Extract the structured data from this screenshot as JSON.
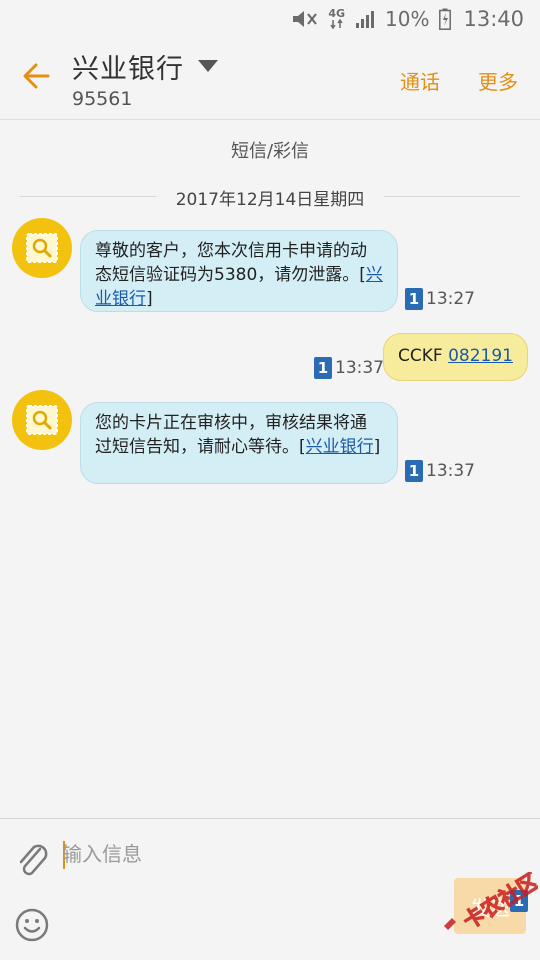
{
  "status_bar": {
    "network": "4G",
    "battery": "10%",
    "time": "13:40"
  },
  "header": {
    "contact_name": "兴业银行",
    "contact_number": "95561",
    "call_label": "通话",
    "more_label": "更多"
  },
  "conversation": {
    "type_label": "短信/彩信",
    "date_label": "2017年12月14日星期四",
    "messages": [
      {
        "direction": "incoming",
        "text": "尊敬的客户，您本次信用卡申请的动态短信验证码为5380，请勿泄露。[",
        "link": "兴业银行",
        "suffix": "]",
        "sim": "1",
        "time": "13:27"
      },
      {
        "direction": "outgoing",
        "text": "CCKF ",
        "link": "082191",
        "sim": "1",
        "time": "13:37"
      },
      {
        "direction": "incoming",
        "text": "您的卡片正在审核中，审核结果将通过短信告知，请耐心等待。[",
        "link": "兴业银行",
        "suffix": "]",
        "sim": "1",
        "time": "13:37"
      }
    ]
  },
  "composer": {
    "placeholder": "输入信息",
    "send_label": "发送",
    "send_sim": "1"
  },
  "watermark": {
    "text": "卡农社区"
  },
  "colors": {
    "accent": "#e58f12",
    "incoming_bubble": "#d4eef6",
    "outgoing_bubble": "#f7ec9c",
    "avatar": "#f2c20f",
    "sim_badge": "#2a6cb3",
    "link": "#1a5aa8"
  },
  "icons": {
    "back": "arrow-left-icon",
    "dropdown": "triangle-down-icon",
    "avatar": "search-card-icon",
    "attach": "paperclip-icon",
    "emoji": "smiley-icon",
    "mute": "mute-icon",
    "signal": "signal-icon",
    "battery": "battery-icon"
  }
}
